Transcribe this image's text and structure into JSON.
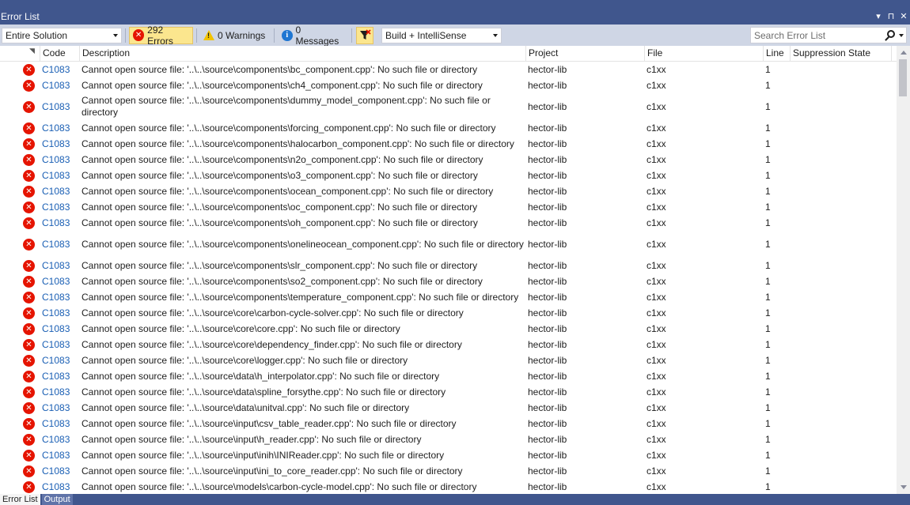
{
  "window": {
    "title": "Error List",
    "controls": [
      "▾",
      "⊓",
      "✕"
    ]
  },
  "toolbar": {
    "scope": "Entire Solution",
    "errors_label": "292 Errors",
    "warnings_label": "0 Warnings",
    "messages_label": "0 Messages",
    "build_filter": "Build + IntelliSense",
    "search_placeholder": "Search Error List"
  },
  "columns": {
    "code": "Code",
    "description": "Description",
    "project": "Project",
    "file": "File",
    "line": "Line",
    "suppression": "Suppression State"
  },
  "rows": [
    {
      "code": "C1083",
      "description": "Cannot open source file: '..\\..\\source\\components\\bc_component.cpp': No such file or directory",
      "project": "hector-lib",
      "file": "c1xx",
      "line": "1",
      "suppression": "",
      "tall": false
    },
    {
      "code": "C1083",
      "description": "Cannot open source file: '..\\..\\source\\components\\ch4_component.cpp': No such file or directory",
      "project": "hector-lib",
      "file": "c1xx",
      "line": "1",
      "suppression": "",
      "tall": false
    },
    {
      "code": "C1083",
      "description": "Cannot open source file: '..\\..\\source\\components\\dummy_model_component.cpp': No such file or directory",
      "project": "hector-lib",
      "file": "c1xx",
      "line": "1",
      "suppression": "",
      "tall": true
    },
    {
      "code": "C1083",
      "description": "Cannot open source file: '..\\..\\source\\components\\forcing_component.cpp': No such file or directory",
      "project": "hector-lib",
      "file": "c1xx",
      "line": "1",
      "suppression": "",
      "tall": false
    },
    {
      "code": "C1083",
      "description": "Cannot open source file: '..\\..\\source\\components\\halocarbon_component.cpp': No such file or directory",
      "project": "hector-lib",
      "file": "c1xx",
      "line": "1",
      "suppression": "",
      "tall": false
    },
    {
      "code": "C1083",
      "description": "Cannot open source file: '..\\..\\source\\components\\n2o_component.cpp': No such file or directory",
      "project": "hector-lib",
      "file": "c1xx",
      "line": "1",
      "suppression": "",
      "tall": false
    },
    {
      "code": "C1083",
      "description": "Cannot open source file: '..\\..\\source\\components\\o3_component.cpp': No such file or directory",
      "project": "hector-lib",
      "file": "c1xx",
      "line": "1",
      "suppression": "",
      "tall": false
    },
    {
      "code": "C1083",
      "description": "Cannot open source file: '..\\..\\source\\components\\ocean_component.cpp': No such file or directory",
      "project": "hector-lib",
      "file": "c1xx",
      "line": "1",
      "suppression": "",
      "tall": false
    },
    {
      "code": "C1083",
      "description": "Cannot open source file: '..\\..\\source\\components\\oc_component.cpp': No such file or directory",
      "project": "hector-lib",
      "file": "c1xx",
      "line": "1",
      "suppression": "",
      "tall": false
    },
    {
      "code": "C1083",
      "description": "Cannot open source file: '..\\..\\source\\components\\oh_component.cpp': No such file or directory",
      "project": "hector-lib",
      "file": "c1xx",
      "line": "1",
      "suppression": "",
      "tall": false
    },
    {
      "code": "C1083",
      "description": "Cannot open source file: '..\\..\\source\\components\\onelineocean_component.cpp': No such file or directory",
      "project": "hector-lib",
      "file": "c1xx",
      "line": "1",
      "suppression": "",
      "tall": true
    },
    {
      "code": "C1083",
      "description": "Cannot open source file: '..\\..\\source\\components\\slr_component.cpp': No such file or directory",
      "project": "hector-lib",
      "file": "c1xx",
      "line": "1",
      "suppression": "",
      "tall": false
    },
    {
      "code": "C1083",
      "description": "Cannot open source file: '..\\..\\source\\components\\so2_component.cpp': No such file or directory",
      "project": "hector-lib",
      "file": "c1xx",
      "line": "1",
      "suppression": "",
      "tall": false
    },
    {
      "code": "C1083",
      "description": "Cannot open source file: '..\\..\\source\\components\\temperature_component.cpp': No such file or directory",
      "project": "hector-lib",
      "file": "c1xx",
      "line": "1",
      "suppression": "",
      "tall": false
    },
    {
      "code": "C1083",
      "description": "Cannot open source file: '..\\..\\source\\core\\carbon-cycle-solver.cpp': No such file or directory",
      "project": "hector-lib",
      "file": "c1xx",
      "line": "1",
      "suppression": "",
      "tall": false
    },
    {
      "code": "C1083",
      "description": "Cannot open source file: '..\\..\\source\\core\\core.cpp': No such file or directory",
      "project": "hector-lib",
      "file": "c1xx",
      "line": "1",
      "suppression": "",
      "tall": false
    },
    {
      "code": "C1083",
      "description": "Cannot open source file: '..\\..\\source\\core\\dependency_finder.cpp': No such file or directory",
      "project": "hector-lib",
      "file": "c1xx",
      "line": "1",
      "suppression": "",
      "tall": false
    },
    {
      "code": "C1083",
      "description": "Cannot open source file: '..\\..\\source\\core\\logger.cpp': No such file or directory",
      "project": "hector-lib",
      "file": "c1xx",
      "line": "1",
      "suppression": "",
      "tall": false
    },
    {
      "code": "C1083",
      "description": "Cannot open source file: '..\\..\\source\\data\\h_interpolator.cpp': No such file or directory",
      "project": "hector-lib",
      "file": "c1xx",
      "line": "1",
      "suppression": "",
      "tall": false
    },
    {
      "code": "C1083",
      "description": "Cannot open source file: '..\\..\\source\\data\\spline_forsythe.cpp': No such file or directory",
      "project": "hector-lib",
      "file": "c1xx",
      "line": "1",
      "suppression": "",
      "tall": false
    },
    {
      "code": "C1083",
      "description": "Cannot open source file: '..\\..\\source\\data\\unitval.cpp': No such file or directory",
      "project": "hector-lib",
      "file": "c1xx",
      "line": "1",
      "suppression": "",
      "tall": false
    },
    {
      "code": "C1083",
      "description": "Cannot open source file: '..\\..\\source\\input\\csv_table_reader.cpp': No such file or directory",
      "project": "hector-lib",
      "file": "c1xx",
      "line": "1",
      "suppression": "",
      "tall": false
    },
    {
      "code": "C1083",
      "description": "Cannot open source file: '..\\..\\source\\input\\h_reader.cpp': No such file or directory",
      "project": "hector-lib",
      "file": "c1xx",
      "line": "1",
      "suppression": "",
      "tall": false
    },
    {
      "code": "C1083",
      "description": "Cannot open source file: '..\\..\\source\\input\\inih\\INIReader.cpp': No such file or directory",
      "project": "hector-lib",
      "file": "c1xx",
      "line": "1",
      "suppression": "",
      "tall": false
    },
    {
      "code": "C1083",
      "description": "Cannot open source file: '..\\..\\source\\input\\ini_to_core_reader.cpp': No such file or directory",
      "project": "hector-lib",
      "file": "c1xx",
      "line": "1",
      "suppression": "",
      "tall": false
    },
    {
      "code": "C1083",
      "description": "Cannot open source file: '..\\..\\source\\models\\carbon-cycle-model.cpp': No such file or directory",
      "project": "hector-lib",
      "file": "c1xx",
      "line": "1",
      "suppression": "",
      "tall": false
    }
  ],
  "bottom_tabs": [
    "Error List",
    "Output"
  ],
  "icons": {
    "error": "error-circle-icon",
    "warning": "warning-triangle-icon",
    "info": "info-circle-icon",
    "filter": "clear-filter-icon",
    "search": "search-icon"
  },
  "colors": {
    "chrome": "#40568d",
    "toolbar": "#cfd6e5",
    "error_red": "#e51400",
    "code_link": "#1a5fb4",
    "active_filter": "#fbe68e"
  }
}
